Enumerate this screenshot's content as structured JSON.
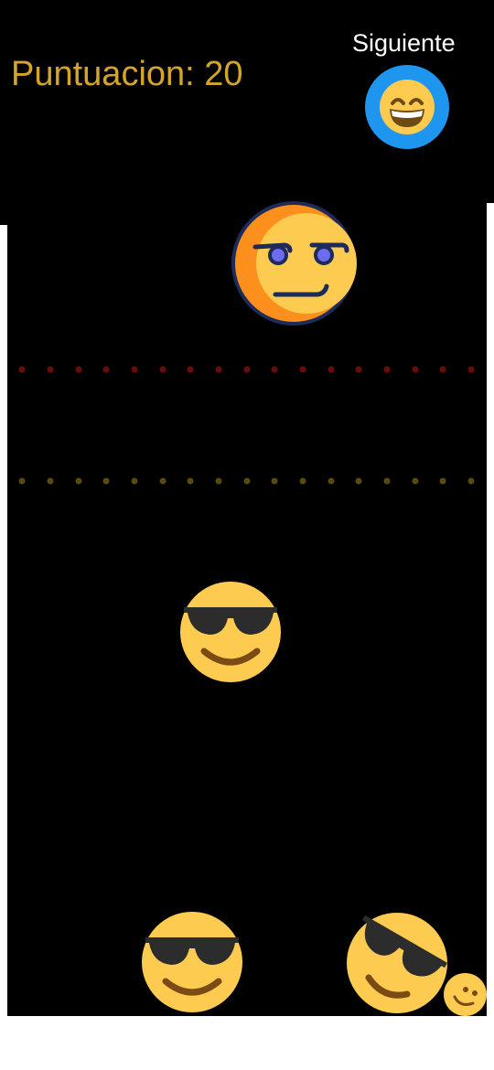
{
  "hud": {
    "score_label": "Puntuacion: 20",
    "next_label": "Siguiente"
  },
  "lines": {
    "red_color": "#6b0c0c",
    "yellow_color": "#5a4a0c"
  },
  "colors": {
    "score_text": "#d4a52a",
    "next_button": "#1e96f0",
    "emoji_face": "#fdcb4f"
  },
  "pieces": [
    {
      "icon": "smirk-face-icon"
    },
    {
      "icon": "sunglasses-face-icon"
    },
    {
      "icon": "sunglasses-face-icon"
    },
    {
      "icon": "tilted-sunglasses-face-icon"
    },
    {
      "icon": "small-smile-face-icon"
    }
  ],
  "next_piece": {
    "icon": "grinning-face-icon"
  }
}
